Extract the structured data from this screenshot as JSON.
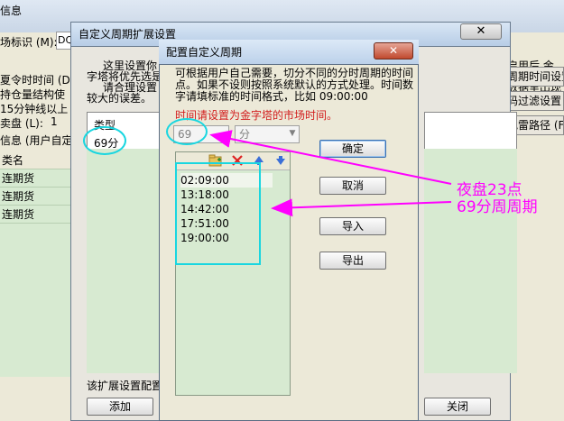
{
  "background_window": {
    "title": "信息",
    "label_market_code": "场标识 (M):",
    "code_value": "DQ",
    "options": [
      "夏令时时间 (D",
      "持仓量结构使",
      "15分钟线以上"
    ],
    "label_sell_board": "卖盘 (L):",
    "sell_board_value": "1",
    "label_user_info": "信息 (用户自定",
    "grid_header": "类名",
    "grid_rows": [
      "连期货",
      "连期货",
      "连期货"
    ],
    "right_texts": [
      "周期启用后,金",
      "参与数据里出现"
    ],
    "right_buttons": [
      "周期时间设置",
      "码过滤设置 (F",
      "地雷路径 (F)"
    ]
  },
  "extend_dialog": {
    "title": "自定义周期扩展设置",
    "close_glyph": "✕",
    "intro_lines": [
      "这里设置你",
      "字塔将优先选是",
      "请合理设置",
      "较大的误差。"
    ],
    "list_header": "类型",
    "list_item": "69分",
    "footer_text": "该扩展设置配置",
    "add_button": "添加",
    "close_button": "关闭"
  },
  "config_dialog": {
    "title": "配置自定义周期",
    "close_glyph": "✕",
    "description": "可根据用户自己需要，切分不同的分时周期的时间点。如果不设则按照系统默认的方式处理。时间数字请填标准的时间格式，比如 09:00:00",
    "notice": "时间请设置为金字塔的市场时间。",
    "period_value": "69",
    "unit_value": "分",
    "toolbar_icons": [
      "folder-add-icon",
      "delete-icon",
      "move-up-icon",
      "move-down-icon"
    ],
    "time_points": [
      "02:09:00",
      "13:18:00",
      "14:42:00",
      "17:51:00",
      "19:00:00"
    ],
    "buttons": {
      "confirm": "确定",
      "cancel": "取消",
      "import": "导入",
      "export": "导出"
    }
  },
  "annotation": {
    "line1": "夜盘23点",
    "line2": "69分周周期",
    "color": "#ff00ff",
    "highlight_color": "#19d6e0"
  }
}
